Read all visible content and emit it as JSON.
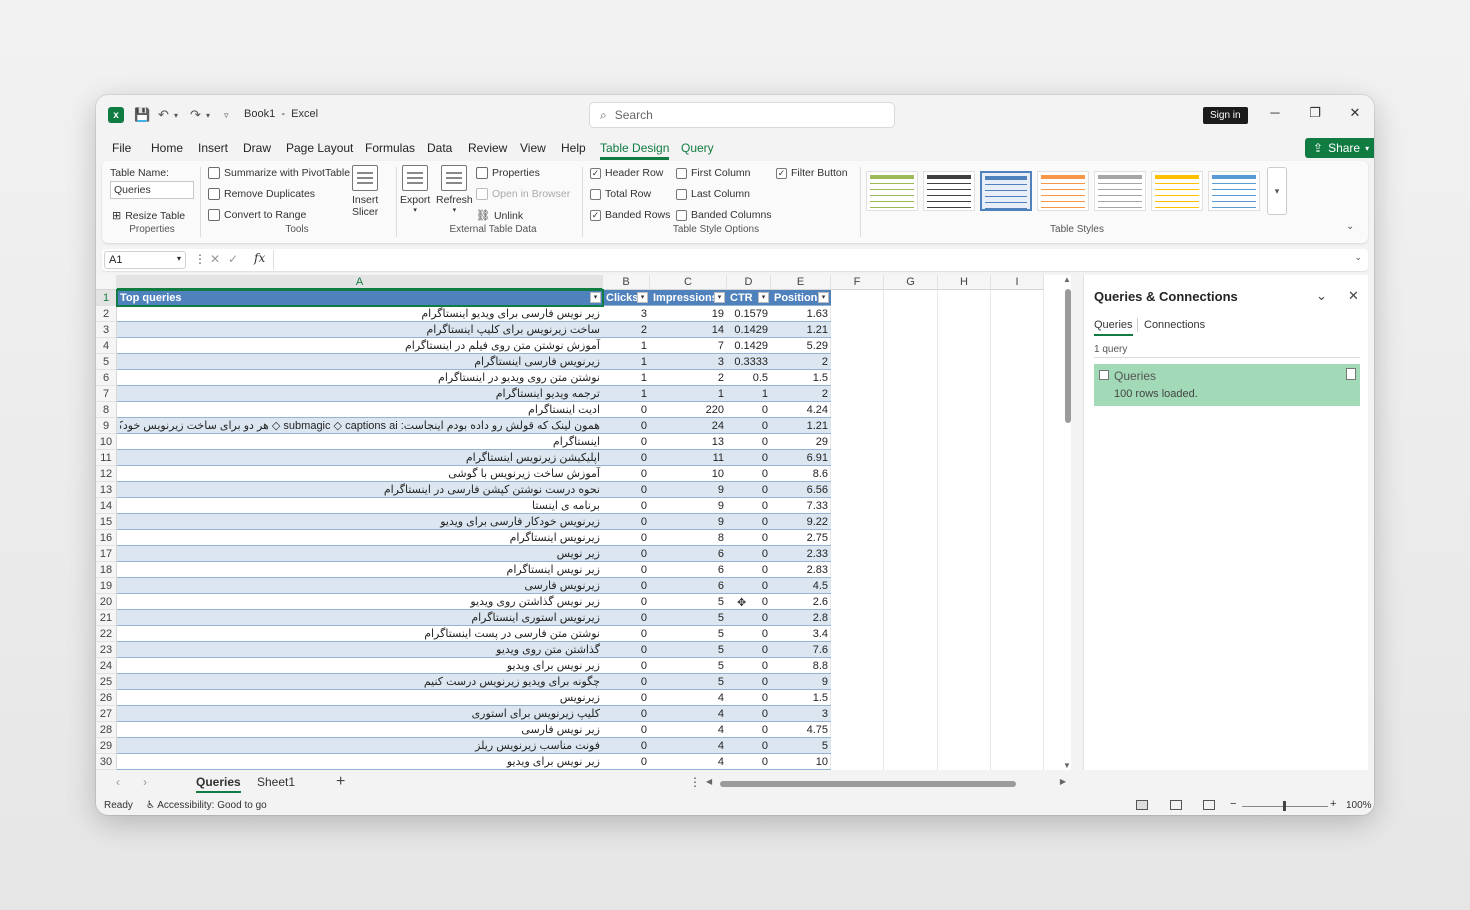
{
  "window": {
    "title": "Book1",
    "app": "Excel",
    "title_sep": "-",
    "search_placeholder": "Search",
    "signin_label": "Sign in",
    "share_label": "Share"
  },
  "menu": [
    "File",
    "Home",
    "Insert",
    "Draw",
    "Page Layout",
    "Formulas",
    "Data",
    "Review",
    "View",
    "Help",
    "Table Design",
    "Query"
  ],
  "ribbon": {
    "table_name_label": "Table Name:",
    "table_name_value": "Queries",
    "resize_table": "Resize Table",
    "properties_group": "Properties",
    "summarize_pivot": "Summarize with PivotTable",
    "remove_duplicates": "Remove Duplicates",
    "convert_to_range": "Convert to Range",
    "tools_group": "Tools",
    "insert_slicer_l1": "Insert",
    "insert_slicer_l2": "Slicer",
    "export": "Export",
    "refresh": "Refresh",
    "properties_btn": "Properties",
    "open_in_browser": "Open in Browser",
    "unlink": "Unlink",
    "external_group": "External Table Data",
    "header_row": "Header Row",
    "total_row": "Total Row",
    "banded_rows": "Banded Rows",
    "first_column": "First Column",
    "last_column": "Last Column",
    "banded_columns": "Banded Columns",
    "filter_button": "Filter Button",
    "style_options_group": "Table Style Options",
    "table_styles_group": "Table Styles",
    "style_colors": [
      "#9bbb59",
      "#404040",
      "#4f81bd",
      "#f79646",
      "#a5a5a5",
      "#ffc000",
      "#5b9bd5"
    ]
  },
  "formula_bar": {
    "name_box": "A1",
    "fx": "fx",
    "value": ""
  },
  "columns": [
    "A",
    "B",
    "C",
    "D",
    "E",
    "F",
    "G",
    "H",
    "I"
  ],
  "table": {
    "headers": [
      "Top queries",
      "Clicks",
      "Impressions",
      "CTR",
      "Position"
    ],
    "rows": [
      [
        "زیر نویس فارسی برای ویدیو اینستاگرام",
        "3",
        "19",
        "0.1579",
        "1.63"
      ],
      [
        "ساخت زیرنویس برای کلیپ اینستاگرام",
        "2",
        "14",
        "0.1429",
        "1.21"
      ],
      [
        "آموزش نوشتن متن روی فیلم در اینستاگرام",
        "1",
        "7",
        "0.1429",
        "5.29"
      ],
      [
        "زیرنویس فارسی اینستاگرام",
        "1",
        "3",
        "0.3333",
        "2"
      ],
      [
        "نوشتن متن روی ویدیو در اینستاگرام",
        "1",
        "2",
        "0.5",
        "1.5"
      ],
      [
        "ترجمه ویدیو اینستاگرام",
        "1",
        "1",
        "1",
        "2"
      ],
      [
        "ادیت اینستاگرام",
        "0",
        "220",
        "0",
        "4.24"
      ],
      [
        "همون لینک که قولش رو داده بودم اینجاست: submagic ◇ captions ai ◇ هر دو برای ساخت زیرنویس خودکار، ادیت ویدیو",
        "0",
        "24",
        "0",
        "1.21"
      ],
      [
        "اینستاگرام",
        "0",
        "13",
        "0",
        "29"
      ],
      [
        "اپلیکیشن زیرنویس اینستاگرام",
        "0",
        "11",
        "0",
        "6.91"
      ],
      [
        "آموزش ساخت زیرنویس با گوشی",
        "0",
        "10",
        "0",
        "8.6"
      ],
      [
        "نحوه درست نوشتن کپشن فارسی در اینستاگرام",
        "0",
        "9",
        "0",
        "6.56"
      ],
      [
        "برنامه ی اینستا",
        "0",
        "9",
        "0",
        "7.33"
      ],
      [
        "زیرنویس خودکار فارسی برای ویدیو",
        "0",
        "9",
        "0",
        "9.22"
      ],
      [
        "زیرنویس اینستاگرام",
        "0",
        "8",
        "0",
        "2.75"
      ],
      [
        "زیر نویس",
        "0",
        "6",
        "0",
        "2.33"
      ],
      [
        "زیر نویس اینستاگرام",
        "0",
        "6",
        "0",
        "2.83"
      ],
      [
        "زیرنویس فارسی",
        "0",
        "6",
        "0",
        "4.5"
      ],
      [
        "زیر نویس گذاشتن روی ویدیو",
        "0",
        "5",
        "0",
        "2.6"
      ],
      [
        "زیرنویس استوری اینستاگرام",
        "0",
        "5",
        "0",
        "2.8"
      ],
      [
        "نوشتن متن فارسی در پست اینستاگرام",
        "0",
        "5",
        "0",
        "3.4"
      ],
      [
        "گذاشتن متن روی ویدیو",
        "0",
        "5",
        "0",
        "7.6"
      ],
      [
        "زیر نویس برای ویدیو",
        "0",
        "5",
        "0",
        "8.8"
      ],
      [
        "چگونه برای ویدیو زیرنویس درست کنیم",
        "0",
        "5",
        "0",
        "9"
      ],
      [
        "زیرنویس",
        "0",
        "4",
        "0",
        "1.5"
      ],
      [
        "کلیپ زیرنویس برای استوری",
        "0",
        "4",
        "0",
        "3"
      ],
      [
        "زیر نویس فارسی",
        "0",
        "4",
        "0",
        "4.75"
      ],
      [
        "فونت مناسب زیرنویس ریلز",
        "0",
        "4",
        "0",
        "5"
      ],
      [
        "زیر نویس برای ویدیو",
        "0",
        "4",
        "0",
        "10"
      ]
    ]
  },
  "queries_panel": {
    "title": "Queries & Connections",
    "tab_queries": "Queries",
    "tab_connections": "Connections",
    "count": "1 query",
    "item_name": "Queries",
    "item_status": "100 rows loaded."
  },
  "sheets": [
    "Queries",
    "Sheet1"
  ],
  "active_sheet": "Queries",
  "status": {
    "ready": "Ready",
    "accessibility": "Accessibility: Good to go",
    "zoom": "100%"
  }
}
